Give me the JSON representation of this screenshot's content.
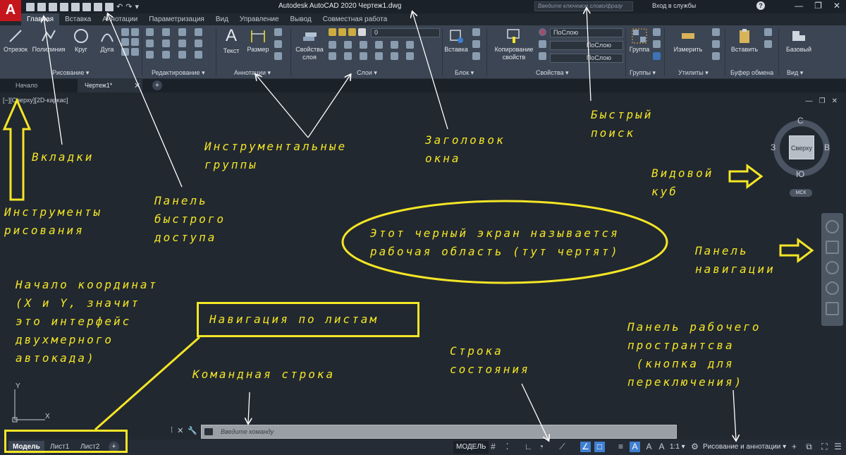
{
  "window": {
    "app_logo": "A",
    "title": "Autodesk AutoCAD 2020    Чертеж1.dwg",
    "search_placeholder": "Введите ключевое слово/фразу",
    "login": "Вход в службы",
    "help": "?",
    "controls": [
      "—",
      "❐",
      "✕"
    ]
  },
  "ribbon_tabs": [
    "Главная",
    "Вставка",
    "Аннотации",
    "Параметризация",
    "Вид",
    "Управление",
    "Вывод",
    "Совместная работа"
  ],
  "ribbon": {
    "draw": {
      "buttons": [
        "Отрезок",
        "Полилиния",
        "Круг",
        "Дуга"
      ],
      "label": "Рисование"
    },
    "modify": {
      "label": "Редактирование"
    },
    "annotation": {
      "buttons": [
        "Текст",
        "Размер"
      ],
      "label": "Аннотации"
    },
    "layers": {
      "buttons": [
        "Свойства\nслоя"
      ],
      "current_layer": "0",
      "label": "Слои"
    },
    "block": {
      "buttons": [
        "Вставка"
      ],
      "label": "Блок"
    },
    "properties": {
      "buttons": [
        "Копирование\nсвойств"
      ],
      "dropdowns": [
        "ПоСлою",
        "ПоСлою",
        "ПоСлою"
      ],
      "label": "Свойства"
    },
    "groups": {
      "buttons": [
        "Группа"
      ],
      "label": "Группы"
    },
    "utilities": {
      "buttons": [
        "Измерить"
      ],
      "label": "Утилиты"
    },
    "clipboard": {
      "buttons": [
        "Вставить"
      ],
      "label": "Буфер обмена"
    },
    "view": {
      "buttons": [
        "Базовый"
      ],
      "label": "Вид"
    }
  },
  "file_tabs": [
    "Начало",
    "Чертеж1*"
  ],
  "viewport_label": "[−][Сверху][2D-каркас]",
  "viewcube": {
    "face": "Сверху",
    "n": "С",
    "s": "Ю",
    "w": "З",
    "e": "В",
    "ucs": "МСК"
  },
  "ucs_axes": {
    "x": "X",
    "y": "Y"
  },
  "command_line": {
    "placeholder": "Введите команду"
  },
  "layout_tabs": [
    "Модель",
    "Лист1",
    "Лист2"
  ],
  "status": {
    "model": "МОДЕЛЬ",
    "scale": "1:1",
    "workspace": "Рисование и аннотации"
  },
  "annotations": {
    "tabs": "Вкладки",
    "draw_tools": "Инструменты\nрисования",
    "qat": "Панель\nбыстрого\nдоступа",
    "tool_groups": "Инструментальные\nгруппы",
    "window_title": "Заголовок\nокна",
    "quick_search": "Быстрый\nпоиск",
    "viewcube": "Видовой\nкуб",
    "workspace_area": "Этот черный экран называется\nрабочая область (тут чертят)",
    "nav_panel": "Панель\nнавигации",
    "origin": "Начало координат\n(X и Y, значит\nэто интерфейс\nдвухмерного\nавтокада)",
    "sheet_nav": "Навигация по листам",
    "command_line": "Командная строка",
    "status_line": "Строка\nсостояния",
    "workspace_panel": "Панель рабочего\nпространтсва\n (кнопка для\nпереключения)"
  },
  "colors": {
    "background": "#212830",
    "ribbon": "#3b4553",
    "annotation": "#f4e526",
    "accent": "#3f7fd1"
  }
}
